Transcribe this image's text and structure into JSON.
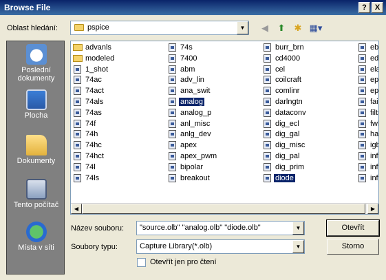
{
  "window": {
    "title": "Browse File",
    "help_label": "?",
    "close_label": "X"
  },
  "lookin": {
    "label": "Oblast hledání:",
    "value": "pspice"
  },
  "toolbar": {
    "back_icon": "back-icon",
    "up_icon": "up-folder-icon",
    "new_folder_icon": "new-folder-icon",
    "view_menu_icon": "view-menu-icon"
  },
  "places": [
    {
      "label": "Poslední dokumenty",
      "icon": "recent-documents-icon"
    },
    {
      "label": "Plocha",
      "icon": "desktop-icon"
    },
    {
      "label": "Dokumenty",
      "icon": "documents-icon"
    },
    {
      "label": "Tento počítač",
      "icon": "my-computer-icon"
    },
    {
      "label": "Místa v síti",
      "icon": "network-places-icon"
    }
  ],
  "files": {
    "columns": [
      [
        {
          "name": "advanls",
          "type": "folder"
        },
        {
          "name": "modeled",
          "type": "folder"
        },
        {
          "name": "1_shot",
          "type": "file"
        },
        {
          "name": "74ac",
          "type": "file"
        },
        {
          "name": "74act",
          "type": "file"
        },
        {
          "name": "74als",
          "type": "file"
        },
        {
          "name": "74as",
          "type": "file"
        },
        {
          "name": "74f",
          "type": "file"
        },
        {
          "name": "74h",
          "type": "file"
        },
        {
          "name": "74hc",
          "type": "file"
        },
        {
          "name": "74hct",
          "type": "file"
        },
        {
          "name": "74l",
          "type": "file"
        },
        {
          "name": "74ls",
          "type": "file"
        }
      ],
      [
        {
          "name": "74s",
          "type": "file"
        },
        {
          "name": "7400",
          "type": "file"
        },
        {
          "name": "abm",
          "type": "file"
        },
        {
          "name": "adv_lin",
          "type": "file"
        },
        {
          "name": "ana_swit",
          "type": "file"
        },
        {
          "name": "analog",
          "type": "file",
          "selected": true
        },
        {
          "name": "analog_p",
          "type": "file"
        },
        {
          "name": "anl_misc",
          "type": "file"
        },
        {
          "name": "anlg_dev",
          "type": "file"
        },
        {
          "name": "apex",
          "type": "file"
        },
        {
          "name": "apex_pwm",
          "type": "file"
        },
        {
          "name": "bipolar",
          "type": "file"
        },
        {
          "name": "breakout",
          "type": "file"
        }
      ],
      [
        {
          "name": "burr_brn",
          "type": "file"
        },
        {
          "name": "cd4000",
          "type": "file"
        },
        {
          "name": "cel",
          "type": "file"
        },
        {
          "name": "coilcraft",
          "type": "file"
        },
        {
          "name": "comlinr",
          "type": "file"
        },
        {
          "name": "darlngtn",
          "type": "file"
        },
        {
          "name": "dataconv",
          "type": "file"
        },
        {
          "name": "dig_ecl",
          "type": "file"
        },
        {
          "name": "dig_gal",
          "type": "file"
        },
        {
          "name": "dig_misc",
          "type": "file"
        },
        {
          "name": "dig_pal",
          "type": "file"
        },
        {
          "name": "dig_prim",
          "type": "file"
        },
        {
          "name": "diode",
          "type": "file",
          "selected": true
        }
      ],
      [
        {
          "name": "ebi",
          "type": "file"
        },
        {
          "name": "edi",
          "type": "file"
        },
        {
          "name": "ela",
          "type": "file"
        },
        {
          "name": "epc",
          "type": "file"
        },
        {
          "name": "epv",
          "type": "file"
        },
        {
          "name": "fair",
          "type": "file"
        },
        {
          "name": "filts",
          "type": "file"
        },
        {
          "name": "fwb",
          "type": "file"
        },
        {
          "name": "har",
          "type": "file"
        },
        {
          "name": "igb",
          "type": "file"
        },
        {
          "name": "infi",
          "type": "file"
        },
        {
          "name": "infi",
          "type": "file"
        },
        {
          "name": "infi",
          "type": "file"
        }
      ]
    ]
  },
  "form": {
    "filename_label": "Název souboru:",
    "filename_value": "\"source.olb\" \"analog.olb\" \"diode.olb\"",
    "filetype_label": "Soubory typu:",
    "filetype_value": "Capture Library(*.olb)",
    "readonly_label": "Otevřít jen pro čtení"
  },
  "buttons": {
    "open_label": "Otevřít",
    "cancel_label": "Storno"
  },
  "colors": {
    "titlebar": "#0A246A",
    "selection": "#0A246A",
    "places_bg": "#808080",
    "dialog_bg": "#ECE9D8"
  }
}
